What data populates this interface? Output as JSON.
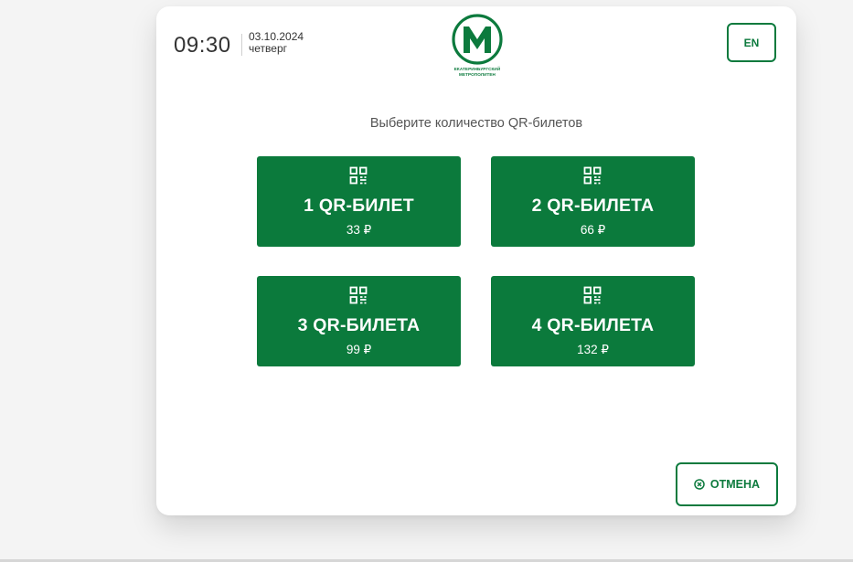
{
  "header": {
    "time": "09:30",
    "date": "03.10.2024",
    "weekday": "четверг",
    "logo_text_line1": "ЕКАТЕРИНБУРГСКИЙ",
    "logo_text_line2": "МЕТРОПОЛИТЕН",
    "language_label": "EN"
  },
  "main": {
    "prompt": "Выберите количество QR-билетов",
    "tickets": [
      {
        "label": "1 QR-БИЛЕТ",
        "price": "33 ₽",
        "icon": "qr-code-icon"
      },
      {
        "label": "2 QR-БИЛЕТА",
        "price": "66 ₽",
        "icon": "qr-code-icon"
      },
      {
        "label": "3 QR-БИЛЕТА",
        "price": "99 ₽",
        "icon": "qr-code-icon"
      },
      {
        "label": "4 QR-БИЛЕТА",
        "price": "132 ₽",
        "icon": "qr-code-icon"
      }
    ]
  },
  "footer": {
    "cancel_label": "ОТМЕНА",
    "cancel_icon": "close-circle-icon"
  },
  "colors": {
    "brand_green": "#0b7a3c",
    "background": "#f4f4f4",
    "card": "#ffffff",
    "text": "#333333"
  }
}
